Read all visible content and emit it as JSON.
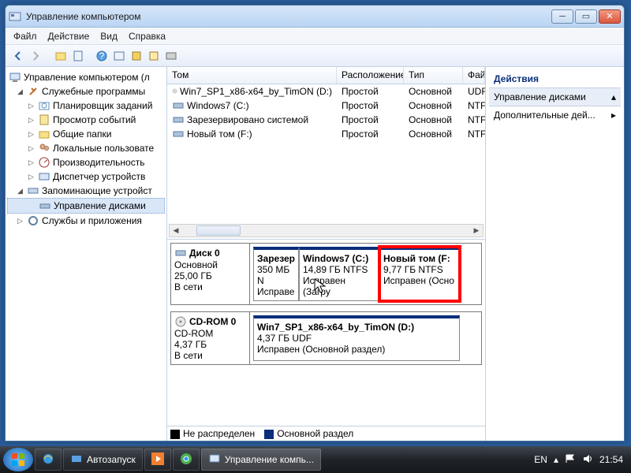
{
  "window": {
    "title": "Управление компьютером"
  },
  "menus": [
    "Файл",
    "Действие",
    "Вид",
    "Справка"
  ],
  "tree": {
    "root": "Управление компьютером (л",
    "group1": "Служебные программы",
    "g1": [
      "Планировщик заданий",
      "Просмотр событий",
      "Общие папки",
      "Локальные пользовате",
      "Производительность",
      "Диспетчер устройств"
    ],
    "group2": "Запоминающие устройст",
    "g2sel": "Управление дисками",
    "group3": "Службы и приложения"
  },
  "cols": {
    "c1": "Том",
    "c2": "Расположение",
    "c3": "Тип",
    "c4": "Фай"
  },
  "colw": {
    "c1": 215,
    "c2": 85,
    "c3": 75,
    "c4": 28
  },
  "volumes": [
    {
      "name": "Win7_SP1_x86-x64_by_TimON (D:)",
      "layout": "Простой",
      "type": "Основной",
      "fs": "UDF",
      "icon": "cd"
    },
    {
      "name": "Windows7 (C:)",
      "layout": "Простой",
      "type": "Основной",
      "fs": "NTF",
      "icon": "hd"
    },
    {
      "name": "Зарезервировано системой",
      "layout": "Простой",
      "type": "Основной",
      "fs": "NTF",
      "icon": "hd"
    },
    {
      "name": "Новый том (F:)",
      "layout": "Простой",
      "type": "Основной",
      "fs": "NTF",
      "icon": "hd"
    }
  ],
  "disk0": {
    "label": "Диск 0",
    "type": "Основной",
    "size": "25,00 ГБ",
    "status": "В сети",
    "p1": {
      "name": "Зарезер",
      "l2": "350 МБ N",
      "l3": "Исправе"
    },
    "p2": {
      "name": "Windows7  (C:)",
      "l2": "14,89 ГБ NTFS",
      "l3": "Исправен (Загру"
    },
    "p3": {
      "name": "Новый том  (F:",
      "l2": "9,77 ГБ NTFS",
      "l3": "Исправен (Осно"
    }
  },
  "cdrom": {
    "label": "CD-ROM 0",
    "type": "CD-ROM",
    "size": "4,37 ГБ",
    "status": "В сети",
    "p1": {
      "name": "Win7_SP1_x86-x64_by_TimON  (D:)",
      "l2": "4,37 ГБ UDF",
      "l3": "Исправен (Основной раздел)"
    }
  },
  "legend": {
    "a": "Не распределен",
    "b": "Основной раздел"
  },
  "actions": {
    "title": "Действия",
    "a1": "Управление дисками",
    "a2": "Дополнительные дей..."
  },
  "taskbar": {
    "t1": "Автозапуск",
    "t2": "Управление компь...",
    "lang": "EN",
    "clock": "21:54"
  }
}
